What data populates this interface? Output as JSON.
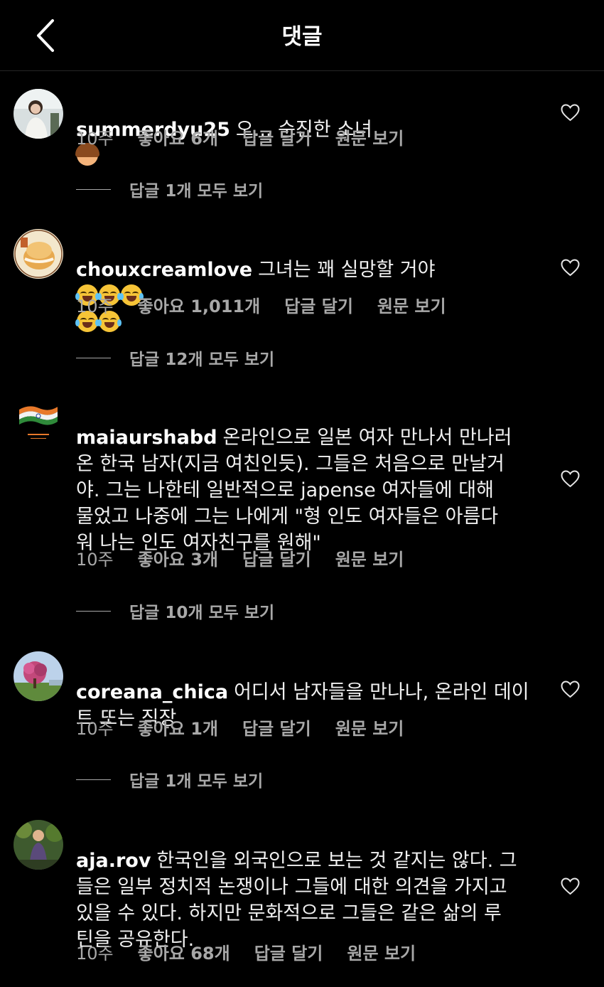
{
  "header": {
    "title": "댓글",
    "back_icon": "chevron-left-icon"
  },
  "comments": [
    {
      "username": "summerdyu25",
      "text": "오... 순진한 소녀",
      "emoji": "girl-face",
      "time": "10주",
      "likes": "좋아요 6개",
      "reply_label": "답글 달기",
      "original_label": "원문 보기",
      "view_replies": "답글 1개 모두 보기"
    },
    {
      "username": "chouxcreamlove",
      "text": "그녀는 꽤 실망할 거야",
      "emoji": "tears-of-joy x5",
      "time": "10주",
      "likes": "좋아요 1,011개",
      "reply_label": "답글 달기",
      "original_label": "원문 보기",
      "view_replies": "답글 12개 모두 보기"
    },
    {
      "username": "maiaurshabd",
      "text": "온라인으로 일본 여자 만나서 만나러\n온 한국 남자(지금 여친인듯). 그들은 처음으로 만날거\n야. 그는 나한테 일반적으로 japense 여자들에 대해\n물었고 나중에 그는 나에게 \"형 인도 여자들은 아름다\n워 나는 인도 여자친구를 원해\"",
      "time": "10주",
      "likes": "좋아요 3개",
      "reply_label": "답글 달기",
      "original_label": "원문 보기",
      "view_replies": "답글 10개 모두 보기"
    },
    {
      "username": "coreana_chica",
      "text": "어디서 남자들을 만나나, 온라인 데이\n트 또는 직장",
      "time": "10주",
      "likes": "좋아요 1개",
      "reply_label": "답글 달기",
      "original_label": "원문 보기",
      "view_replies": "답글 1개 모두 보기"
    },
    {
      "username": "aja.rov",
      "text": "한국인을 외국인으로 보는 것 같지는 않다. 그\n들은 일부 정치적 논쟁이나 그들에 대한 의견을 가지고\n있을 수 있다. 하지만 문화적으로 그들은 같은 삶의 루\n틴을 공유한다.",
      "time": "10주",
      "likes": "좋아요 68개",
      "reply_label": "답글 달기",
      "original_label": "원문 보기"
    }
  ]
}
